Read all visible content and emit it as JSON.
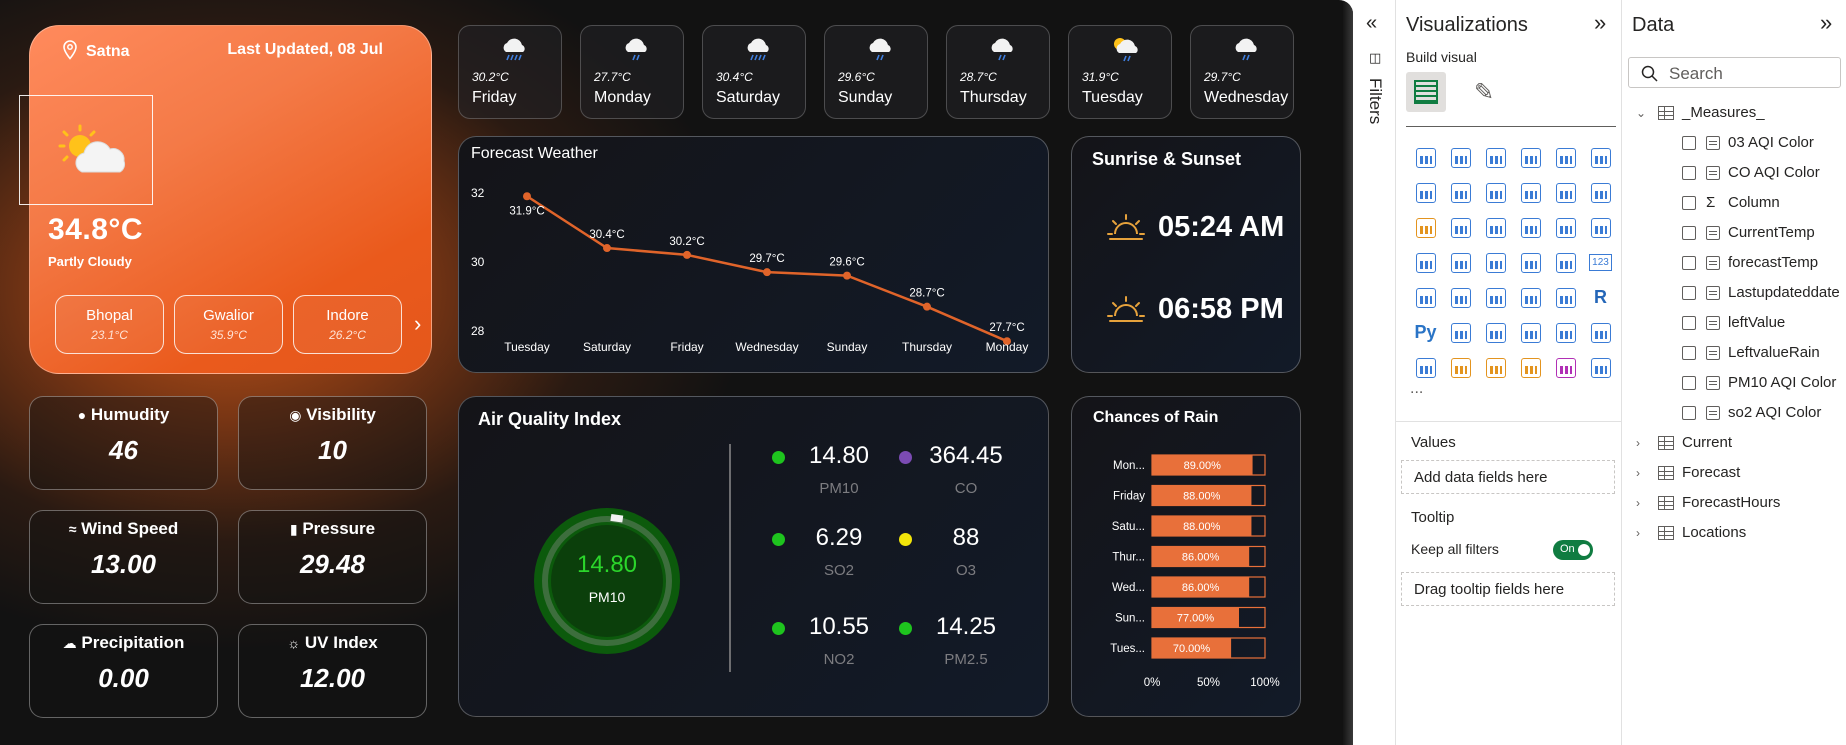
{
  "main": {
    "location": "Satna",
    "last_updated": "Last Updated, 08 Jul",
    "temperature": "34.8°C",
    "condition": "Partly Cloudy",
    "cities": [
      {
        "name": "Bhopal",
        "temp": "23.1°C"
      },
      {
        "name": "Gwalior",
        "temp": "35.9°C"
      },
      {
        "name": "Indore",
        "temp": "26.2°C"
      }
    ],
    "next_icon": "chevron-right-icon"
  },
  "metrics": [
    {
      "label": "Humudity",
      "value": "46",
      "icon": "droplet-icon"
    },
    {
      "label": "Visibility",
      "value": "10",
      "icon": "eye-icon"
    },
    {
      "label": "Wind Speed",
      "value": "13.00",
      "icon": "wind-icon"
    },
    {
      "label": "Pressure",
      "value": "29.48",
      "icon": "thermometer-icon"
    },
    {
      "label": "Precipitation",
      "value": "0.00",
      "icon": "rain-cloud-icon"
    },
    {
      "label": "UV Index",
      "value": "12.00",
      "icon": "sun-outline-icon"
    }
  ],
  "forecast_cards": [
    {
      "temp": "30.2°C",
      "day": "Friday",
      "icon": "rain-cloud-icon"
    },
    {
      "temp": "27.7°C",
      "day": "Monday",
      "icon": "rain-cloud-icon"
    },
    {
      "temp": "30.4°C",
      "day": "Saturday",
      "icon": "rain-cloud-icon"
    },
    {
      "temp": "29.6°C",
      "day": "Sunday",
      "icon": "rain-cloud-icon"
    },
    {
      "temp": "28.7°C",
      "day": "Thursday",
      "icon": "rain-cloud-icon"
    },
    {
      "temp": "31.9°C",
      "day": "Tuesday",
      "icon": "sun-rain-cloud-icon"
    },
    {
      "temp": "29.7°C",
      "day": "Wednesday",
      "icon": "rain-cloud-icon"
    }
  ],
  "forecast_chart": {
    "title": "Forecast Weather",
    "chart_data": {
      "type": "line",
      "categories": [
        "Tuesday",
        "Saturday",
        "Friday",
        "Wednesday",
        "Sunday",
        "Thursday",
        "Monday"
      ],
      "values": [
        31.9,
        30.4,
        30.2,
        29.7,
        29.6,
        28.7,
        27.7
      ],
      "data_labels": [
        "31.9°C",
        "30.4°C",
        "30.2°C",
        "29.7°C",
        "29.6°C",
        "28.7°C",
        "27.7°C"
      ],
      "y_ticks": [
        "32",
        "30",
        "28"
      ],
      "ylim": [
        27.3,
        32.4
      ],
      "color": "#e0642a",
      "grid": false
    }
  },
  "sun": {
    "title": "Sunrise & Sunset",
    "sunrise": "05:24 AM",
    "sunset": "06:58 PM",
    "color": "#e6a23c"
  },
  "aqi": {
    "title": "Air Quality Index",
    "gauge_value": "14.80",
    "gauge_label": "PM10",
    "items": [
      {
        "value": "14.80",
        "name": "PM10",
        "dot_color": "#1ec41e"
      },
      {
        "value": "364.45",
        "name": "CO",
        "dot_color": "#7b4bb3"
      },
      {
        "value": "6.29",
        "name": "SO2",
        "dot_color": "#1ec41e"
      },
      {
        "value": "88",
        "name": "O3",
        "dot_color": "#f2e50a"
      },
      {
        "value": "10.55",
        "name": "NO2",
        "dot_color": "#1ec41e"
      },
      {
        "value": "14.25",
        "name": "PM2.5",
        "dot_color": "#1ec41e"
      }
    ]
  },
  "rain_chart": {
    "title": "Chances of Rain",
    "chart_data": {
      "type": "bar",
      "orientation": "horizontal",
      "categories": [
        "Mon...",
        "Friday",
        "Satu...",
        "Thur...",
        "Wed...",
        "Sun...",
        "Tues..."
      ],
      "values": [
        89,
        88,
        88,
        86,
        86,
        77,
        70
      ],
      "data_labels": [
        "89.00%",
        "88.00%",
        "88.00%",
        "86.00%",
        "86.00%",
        "77.00%",
        "70.00%"
      ],
      "x_ticks": [
        "0%",
        "50%",
        "100%"
      ],
      "xlim": [
        0,
        100
      ],
      "color": "#e8703a"
    }
  },
  "filters": {
    "label": "Filters"
  },
  "visualizations": {
    "title": "Visualizations",
    "build_visual": "Build visual",
    "values_label": "Values",
    "values_placeholder": "Add data fields here",
    "tooltip_label": "Tooltip",
    "keep_filters": "Keep all filters",
    "toggle": "On",
    "tooltip_placeholder": "Drag tooltip fields here",
    "more": "...",
    "py": "Py",
    "r": "R",
    "num": "123"
  },
  "data_pane": {
    "title": "Data",
    "search_placeholder": "Search",
    "tables": [
      {
        "name": "_Measures_",
        "expanded": true,
        "fields": [
          "03 AQI Color",
          "CO AQI Color",
          "Column",
          "CurrentTemp",
          "forecastTemp",
          "Lastupdateddate",
          "leftValue",
          "LeftvalueRain",
          "PM10 AQI Color",
          "so2 AQI Color"
        ]
      },
      {
        "name": "Current",
        "expanded": false
      },
      {
        "name": "Forecast",
        "expanded": false
      },
      {
        "name": "ForecastHours",
        "expanded": false
      },
      {
        "name": "Locations",
        "expanded": false
      }
    ]
  }
}
